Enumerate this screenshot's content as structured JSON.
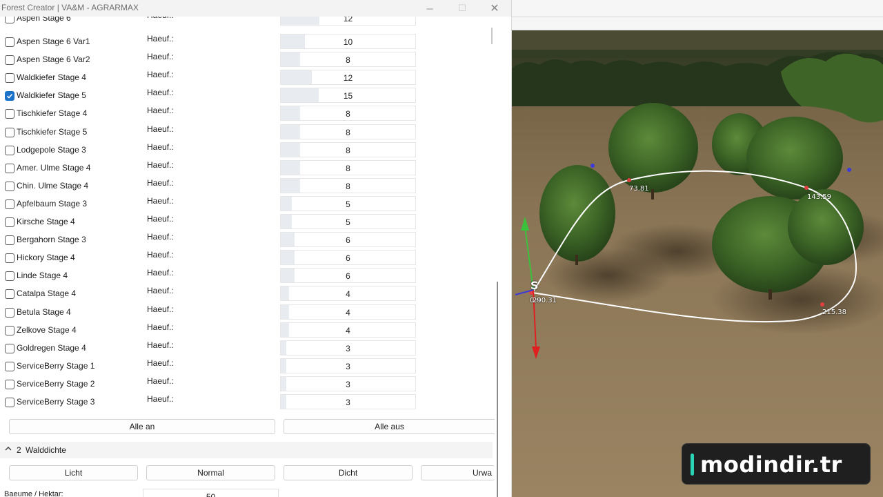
{
  "window": {
    "title": "Forest Creator  |  VA&M - AGRARMAX",
    "minimize_icon": "─",
    "maximize_icon": "☐",
    "close_icon": "✕"
  },
  "haeuf_label": "Haeuf.:",
  "partial_top_row": {
    "name": "Aspen Stage 6",
    "value": "12"
  },
  "tree_rows": [
    {
      "name": "Aspen Stage 6 Var1",
      "value": "10",
      "checked": false,
      "fill": 0.18
    },
    {
      "name": "Aspen Stage 6 Var2",
      "value": "8",
      "checked": false,
      "fill": 0.14
    },
    {
      "name": "Waldkiefer Stage 4",
      "value": "12",
      "checked": false,
      "fill": 0.23
    },
    {
      "name": "Waldkiefer Stage 5",
      "value": "15",
      "checked": true,
      "fill": 0.28
    },
    {
      "name": "Tischkiefer Stage 4",
      "value": "8",
      "checked": false,
      "fill": 0.14
    },
    {
      "name": "Tischkiefer Stage 5",
      "value": "8",
      "checked": false,
      "fill": 0.14
    },
    {
      "name": "Lodgepole Stage 3",
      "value": "8",
      "checked": false,
      "fill": 0.14
    },
    {
      "name": "Amer. Ulme Stage 4",
      "value": "8",
      "checked": false,
      "fill": 0.14
    },
    {
      "name": "Chin. Ulme Stage 4",
      "value": "8",
      "checked": false,
      "fill": 0.14
    },
    {
      "name": "Apfelbaum Stage 3",
      "value": "5",
      "checked": false,
      "fill": 0.08
    },
    {
      "name": "Kirsche Stage 4",
      "value": "5",
      "checked": false,
      "fill": 0.08
    },
    {
      "name": "Bergahorn Stage 3",
      "value": "6",
      "checked": false,
      "fill": 0.1
    },
    {
      "name": "Hickory Stage 4",
      "value": "6",
      "checked": false,
      "fill": 0.1
    },
    {
      "name": "Linde Stage 4",
      "value": "6",
      "checked": false,
      "fill": 0.1
    },
    {
      "name": "Catalpa Stage 4",
      "value": "4",
      "checked": false,
      "fill": 0.06
    },
    {
      "name": "Betula Stage 4",
      "value": "4",
      "checked": false,
      "fill": 0.06
    },
    {
      "name": "Zelkove Stage 4",
      "value": "4",
      "checked": false,
      "fill": 0.06
    },
    {
      "name": "Goldregen Stage 4",
      "value": "3",
      "checked": false,
      "fill": 0.04
    },
    {
      "name": "ServiceBerry Stage 1",
      "value": "3",
      "checked": false,
      "fill": 0.04
    },
    {
      "name": "ServiceBerry Stage 2",
      "value": "3",
      "checked": false,
      "fill": 0.04
    },
    {
      "name": "ServiceBerry Stage 3",
      "value": "3",
      "checked": false,
      "fill": 0.04
    }
  ],
  "buttons": {
    "all_on": "Alle an",
    "all_off": "Alle aus"
  },
  "section": {
    "chevron": "^",
    "number": "2",
    "title": "Walddichte"
  },
  "density_buttons": {
    "light": "Licht",
    "normal": "Normal",
    "dense": "Dicht",
    "primeval": "Urwa"
  },
  "density": {
    "label": "Baeume / Hektar:",
    "value": "50"
  },
  "spline_labels": {
    "l1": "73.81",
    "l2": "143.59",
    "l3": "215.38",
    "l4": "0.0",
    "l5": "290.31"
  },
  "gizmo_label": "S",
  "watermark": "modindir.tr",
  "colors": {
    "check_blue": "#1a73c8",
    "gizmo_green": "#3cc13c",
    "gizmo_red": "#e02020",
    "gizmo_blue": "#3b3bd8",
    "logo_accent": "#2bd3b5",
    "spline_white": "#ffffff"
  }
}
